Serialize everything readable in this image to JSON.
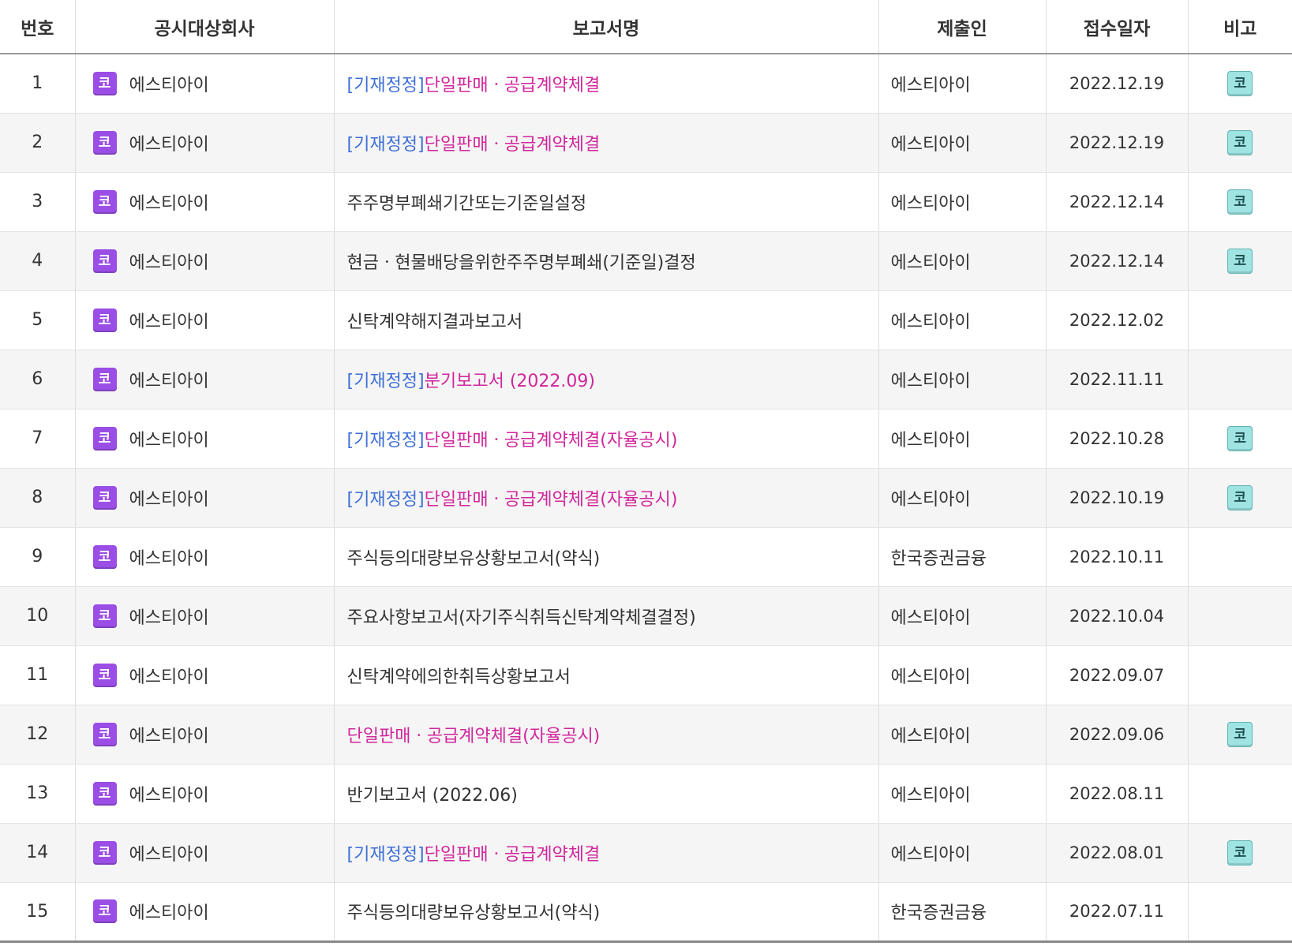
{
  "headers": {
    "num": "번호",
    "company": "공시대상회사",
    "report": "보고서명",
    "filer": "제출인",
    "date": "접수일자",
    "note": "비고"
  },
  "market_badge_text": "코",
  "remark_badge_text": "코",
  "colors": {
    "market_badge": "#9b4ee6",
    "remark_badge": "#9fe3e3",
    "correction_prefix": "#3d6fd6",
    "highlight_report": "#d1269c",
    "normal_report": "#333333"
  },
  "rows": [
    {
      "num": "1",
      "company": "에스티아이",
      "prefix": "[기재정정]",
      "title": "단일판매ㆍ공급계약체결",
      "highlight": true,
      "filer": "에스티아이",
      "date": "2022.12.19",
      "remark": true
    },
    {
      "num": "2",
      "company": "에스티아이",
      "prefix": "[기재정정]",
      "title": "단일판매ㆍ공급계약체결",
      "highlight": true,
      "filer": "에스티아이",
      "date": "2022.12.19",
      "remark": true
    },
    {
      "num": "3",
      "company": "에스티아이",
      "prefix": "",
      "title": "주주명부폐쇄기간또는기준일설정",
      "highlight": false,
      "filer": "에스티아이",
      "date": "2022.12.14",
      "remark": true
    },
    {
      "num": "4",
      "company": "에스티아이",
      "prefix": "",
      "title": "현금ㆍ현물배당을위한주주명부폐쇄(기준일)결정",
      "highlight": false,
      "filer": "에스티아이",
      "date": "2022.12.14",
      "remark": true
    },
    {
      "num": "5",
      "company": "에스티아이",
      "prefix": "",
      "title": "신탁계약해지결과보고서",
      "highlight": false,
      "filer": "에스티아이",
      "date": "2022.12.02",
      "remark": false
    },
    {
      "num": "6",
      "company": "에스티아이",
      "prefix": "[기재정정]",
      "title": "분기보고서 (2022.09)",
      "highlight": true,
      "filer": "에스티아이",
      "date": "2022.11.11",
      "remark": false
    },
    {
      "num": "7",
      "company": "에스티아이",
      "prefix": "[기재정정]",
      "title": "단일판매ㆍ공급계약체결(자율공시)",
      "highlight": true,
      "filer": "에스티아이",
      "date": "2022.10.28",
      "remark": true
    },
    {
      "num": "8",
      "company": "에스티아이",
      "prefix": "[기재정정]",
      "title": "단일판매ㆍ공급계약체결(자율공시)",
      "highlight": true,
      "filer": "에스티아이",
      "date": "2022.10.19",
      "remark": true
    },
    {
      "num": "9",
      "company": "에스티아이",
      "prefix": "",
      "title": "주식등의대량보유상황보고서(약식)",
      "highlight": false,
      "filer": "한국증권금융",
      "date": "2022.10.11",
      "remark": false
    },
    {
      "num": "10",
      "company": "에스티아이",
      "prefix": "",
      "title": "주요사항보고서(자기주식취득신탁계약체결결정)",
      "highlight": false,
      "filer": "에스티아이",
      "date": "2022.10.04",
      "remark": false
    },
    {
      "num": "11",
      "company": "에스티아이",
      "prefix": "",
      "title": "신탁계약에의한취득상황보고서",
      "highlight": false,
      "filer": "에스티아이",
      "date": "2022.09.07",
      "remark": false
    },
    {
      "num": "12",
      "company": "에스티아이",
      "prefix": "",
      "title": "단일판매ㆍ공급계약체결(자율공시)",
      "highlight": true,
      "filer": "에스티아이",
      "date": "2022.09.06",
      "remark": true
    },
    {
      "num": "13",
      "company": "에스티아이",
      "prefix": "",
      "title": "반기보고서 (2022.06)",
      "highlight": false,
      "filer": "에스티아이",
      "date": "2022.08.11",
      "remark": false
    },
    {
      "num": "14",
      "company": "에스티아이",
      "prefix": "[기재정정]",
      "title": "단일판매ㆍ공급계약체결",
      "highlight": true,
      "filer": "에스티아이",
      "date": "2022.08.01",
      "remark": true
    },
    {
      "num": "15",
      "company": "에스티아이",
      "prefix": "",
      "title": "주식등의대량보유상황보고서(약식)",
      "highlight": false,
      "filer": "한국증권금융",
      "date": "2022.07.11",
      "remark": false
    }
  ]
}
